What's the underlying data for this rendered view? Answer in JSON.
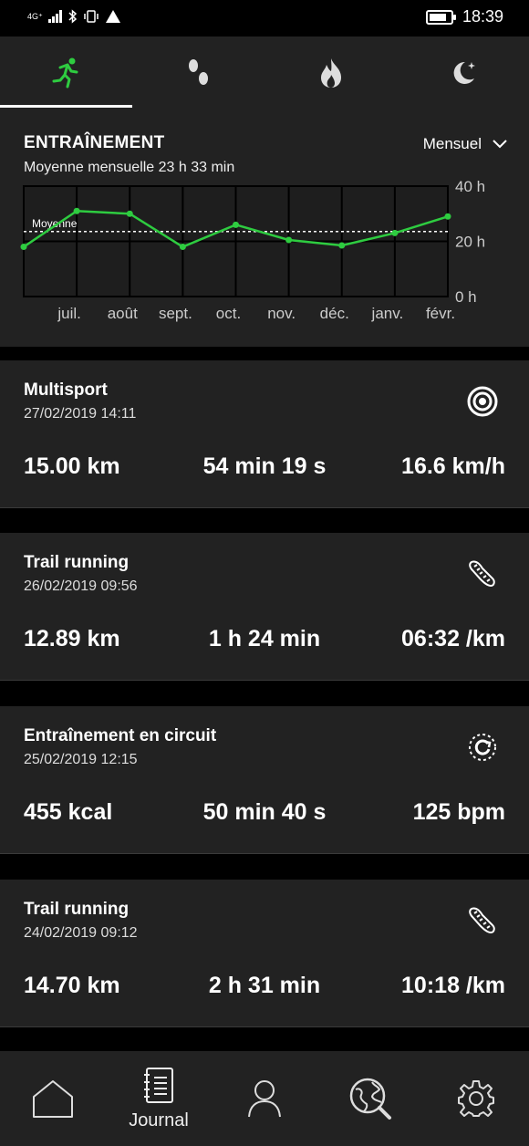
{
  "status": {
    "network": "4G⁺",
    "time": "18:39",
    "battery_level": 0.8
  },
  "top_tabs": [
    {
      "name": "running",
      "active": true
    },
    {
      "name": "steps",
      "active": false
    },
    {
      "name": "calories",
      "active": false
    },
    {
      "name": "sleep",
      "active": false
    }
  ],
  "colors": {
    "accent": "#2ecc40",
    "card": "#222222",
    "background": "#000000"
  },
  "chart": {
    "title": "ENTRAÎNEMENT",
    "subtitle": "Moyenne mensuelle 23 h 33 min",
    "period": "Mensuel",
    "average_label": "Moyenne"
  },
  "chart_data": {
    "type": "line",
    "categories": [
      "juil.",
      "août",
      "sept.",
      "oct.",
      "nov.",
      "déc.",
      "janv.",
      "févr."
    ],
    "x_labels_start_index": 1,
    "all_points": [
      18,
      31,
      30,
      18,
      26,
      20.5,
      18.5,
      23,
      29
    ],
    "average": 23.55,
    "ylim": [
      0,
      40
    ],
    "yticks": [
      "40 h",
      "20 h",
      "0 h"
    ],
    "grid": true
  },
  "activities": [
    {
      "name": "Multisport",
      "date": "27/02/2019 14:11",
      "icon": "multisport-icon",
      "stats": [
        "15.00 km",
        "54 min 19 s",
        "16.6 km/h"
      ]
    },
    {
      "name": "Trail running",
      "date": "26/02/2019 09:56",
      "icon": "shoe-icon",
      "stats": [
        "12.89 km",
        "1 h 24 min",
        "06:32 /km"
      ]
    },
    {
      "name": "Entraînement en circuit",
      "date": "25/02/2019 12:15",
      "icon": "circuit-icon",
      "stats": [
        "455 kcal",
        "50 min 40 s",
        "125 bpm"
      ]
    },
    {
      "name": "Trail running",
      "date": "24/02/2019 09:12",
      "icon": "shoe-icon",
      "stats": [
        "14.70 km",
        "2 h 31 min",
        "10:18 /km"
      ]
    }
  ],
  "bottom_nav": [
    {
      "icon": "home-icon",
      "label": ""
    },
    {
      "icon": "journal-icon",
      "label": "Journal"
    },
    {
      "icon": "profile-icon",
      "label": ""
    },
    {
      "icon": "globe-search-icon",
      "label": ""
    },
    {
      "icon": "gear-icon",
      "label": ""
    }
  ]
}
